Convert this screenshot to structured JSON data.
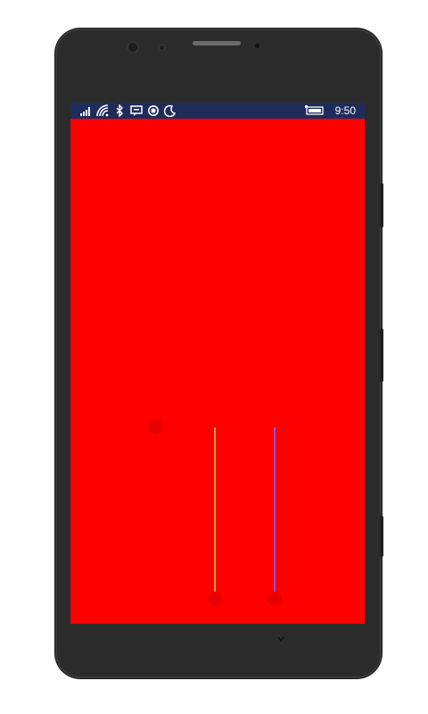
{
  "device": {
    "status_bar": {
      "time": "9:50",
      "icons": [
        "signal-bars-icon",
        "wifi-icon",
        "bluetooth-icon",
        "message-icon",
        "location-icon",
        "quiet-hours-icon",
        "battery-icon"
      ]
    }
  },
  "app": {
    "background_color": "#ff0000",
    "controls": [
      {
        "name": "dot-1",
        "level": 0.0
      },
      {
        "name": "slider-gold",
        "color": "#c89b3c"
      },
      {
        "name": "slider-purple",
        "color": "#a04ad8"
      }
    ]
  },
  "colors": {
    "status_bar": "#1f2c5a",
    "phone_body": "#2b2b2b",
    "accent_red": "#ff0000"
  }
}
